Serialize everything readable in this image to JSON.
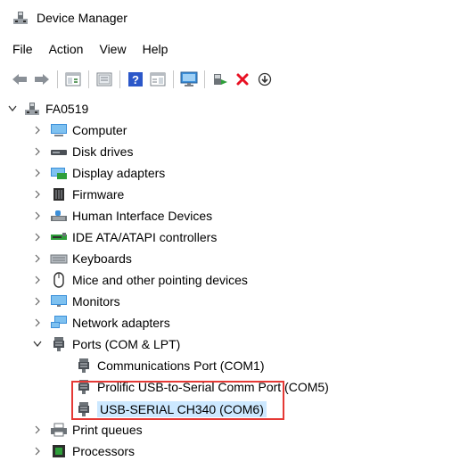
{
  "window": {
    "title": "Device Manager"
  },
  "menu": [
    "File",
    "Action",
    "View",
    "Help"
  ],
  "toolbar": {
    "icons": [
      "back-arrow-icon",
      "forward-arrow-icon",
      "show-hide-console-tree-icon",
      "properties-icon",
      "help-icon",
      "view-icon",
      "monitor-icon",
      "update-driver-icon",
      "uninstall-icon",
      "download-icon"
    ]
  },
  "tree": {
    "root": "FA0519",
    "categories": [
      {
        "label": "Computer",
        "expanded": false
      },
      {
        "label": "Disk drives",
        "expanded": false
      },
      {
        "label": "Display adapters",
        "expanded": false
      },
      {
        "label": "Firmware",
        "expanded": false
      },
      {
        "label": "Human Interface Devices",
        "expanded": false
      },
      {
        "label": "IDE ATA/ATAPI controllers",
        "expanded": false
      },
      {
        "label": "Keyboards",
        "expanded": false
      },
      {
        "label": "Mice and other pointing devices",
        "expanded": false
      },
      {
        "label": "Monitors",
        "expanded": false
      },
      {
        "label": "Network adapters",
        "expanded": false
      },
      {
        "label": "Ports (COM & LPT)",
        "expanded": true
      },
      {
        "label": "Print queues",
        "expanded": false
      },
      {
        "label": "Processors",
        "expanded": false
      }
    ],
    "ports": [
      "Communications Port (COM1)",
      "Prolific USB-to-Serial Comm Port (COM5)",
      "USB-SERIAL CH340 (COM6)"
    ]
  },
  "colors": {
    "highlight_border": "#e53935",
    "selection": "#cce8ff",
    "uninstall_red": "#e81123",
    "update_green": "#2e9e3a"
  }
}
